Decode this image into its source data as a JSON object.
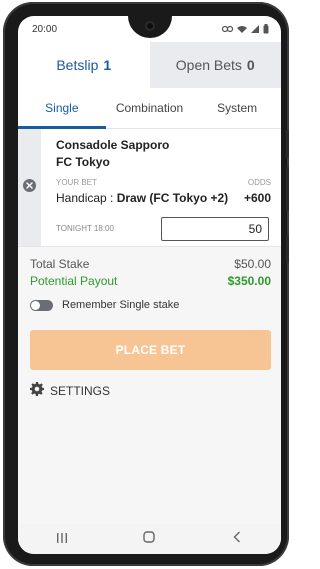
{
  "status": {
    "time": "20:00"
  },
  "top_tabs": [
    {
      "label": "Betslip",
      "count": "1"
    },
    {
      "label": "Open Bets",
      "count": "0"
    }
  ],
  "sub_tabs": [
    {
      "label": "Single"
    },
    {
      "label": "Combination"
    },
    {
      "label": "System"
    }
  ],
  "bet": {
    "home_team": "Consadole Sapporo",
    "away_team": "FC Tokyo",
    "your_bet_label": "YOUR BET",
    "odds_label": "ODDS",
    "market": "Handicap : ",
    "selection": "Draw (FC Tokyo +2)",
    "odds": "+600",
    "time": "TONIGHT 18:00",
    "stake_value": "50"
  },
  "summary": {
    "total_stake_label": "Total Stake",
    "total_stake_value": "$50.00",
    "payout_label": "Potential Payout",
    "payout_value": "$350.00",
    "remember_label": "Remember Single stake",
    "remember_enabled": false
  },
  "place_bet_label": "PLACE BET",
  "settings_label": "SETTINGS",
  "colors": {
    "accent": "#1a5a9e",
    "payout": "#2e9a2e",
    "place_bet_disabled": "#f7c593"
  }
}
